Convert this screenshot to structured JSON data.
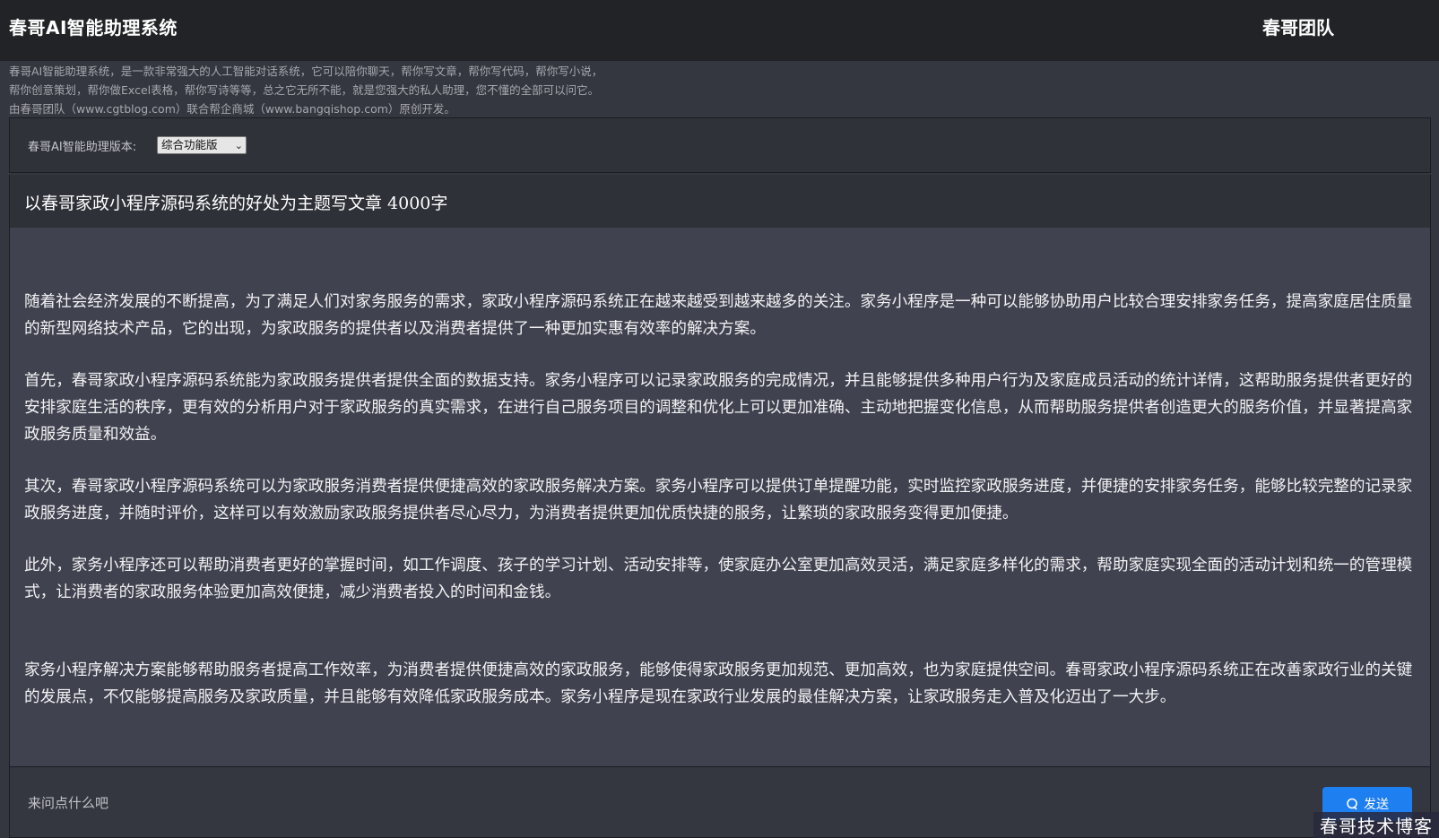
{
  "header": {
    "app_title": "春哥AI智能助理系统",
    "team_name": "春哥团队"
  },
  "intro": {
    "lines": [
      "春哥AI智能助理系统，是一款非常强大的人工智能对话系统，它可以陪你聊天，帮你写文章，帮你写代码，帮你写小说，",
      "帮你创意策划，帮你做Excel表格，帮你写诗等等，总之它无所不能，就是您强大的私人助理，您不懂的全部可以问它。",
      "由春哥团队（www.cgtblog.com）联合帮企商城（www.bangqishop.com）原创开发。"
    ]
  },
  "version": {
    "label": "春哥AI智能助理版本:",
    "selected": "综合功能版"
  },
  "question": "以春哥家政小程序源码系统的好处为主题写文章 4000字",
  "answer": {
    "paragraphs": [
      "  随着社会经济发展的不断提高，为了满足人们对家务服务的需求，家政小程序源码系统正在越来越受到越来越多的关注。家务小程序是一种可以能够协助用户比较合理安排家务任务，提高家庭居住质量的新型网络技术产品，它的出现，为家政服务的提供者以及消费者提供了一种更加实惠有效率的解决方案。",
      "首先，春哥家政小程序源码系统能为家政服务提供者提供全面的数据支持。家务小程序可以记录家政服务的完成情况，并且能够提供多种用户行为及家庭成员活动的统计详情，这帮助服务提供者更好的安排家庭生活的秩序，更有效的分析用户对于家政服务的真实需求，在进行自己服务项目的调整和优化上可以更加准确、主动地把握变化信息，从而帮助服务提供者创造更大的服务价值，并显著提高家政服务质量和效益。",
      "其次，春哥家政小程序源码系统可以为家政服务消费者提供便捷高效的家政服务解决方案。家务小程序可以提供订单提醒功能，实时监控家政服务进度，并便捷的安排家务任务，能够比较完整的记录家政服务进度，并随时评价，这样可以有效激励家政服务提供者尽心尽力，为消费者提供更加优质快捷的服务，让繁琐的家政服务变得更加便捷。",
      "此外，家务小程序还可以帮助消费者更好的掌握时间，如工作调度、孩子的学习计划、活动安排等，使家庭办公室更加高效灵活，满足家庭多样化的需求，帮助家庭实现全面的活动计划和统一的管理模式，让消费者的家政服务体验更加高效便捷，减少消费者投入的时间和金钱。",
      "家务小程序解决方案能够帮助服务者提高工作效率，为消费者提供便捷高效的家政服务，能够使得家政服务更加规范、更加高效，也为家庭提供空间。春哥家政小程序源码系统正在改善家政行业的关键的发展点，不仅能够提高服务及家政质量，并且能够有效降低家政服务成本。家务小程序是现在家政行业发展的最佳解决方案，让家政服务走入普及化迈出了一大步。"
    ]
  },
  "input": {
    "placeholder": "来问点什么吧",
    "send_label": "发送"
  },
  "watermark": "春哥技术博客",
  "colors": {
    "accent": "#1e7ff0",
    "topbar": "#222326",
    "answer_bg": "#40424f"
  }
}
